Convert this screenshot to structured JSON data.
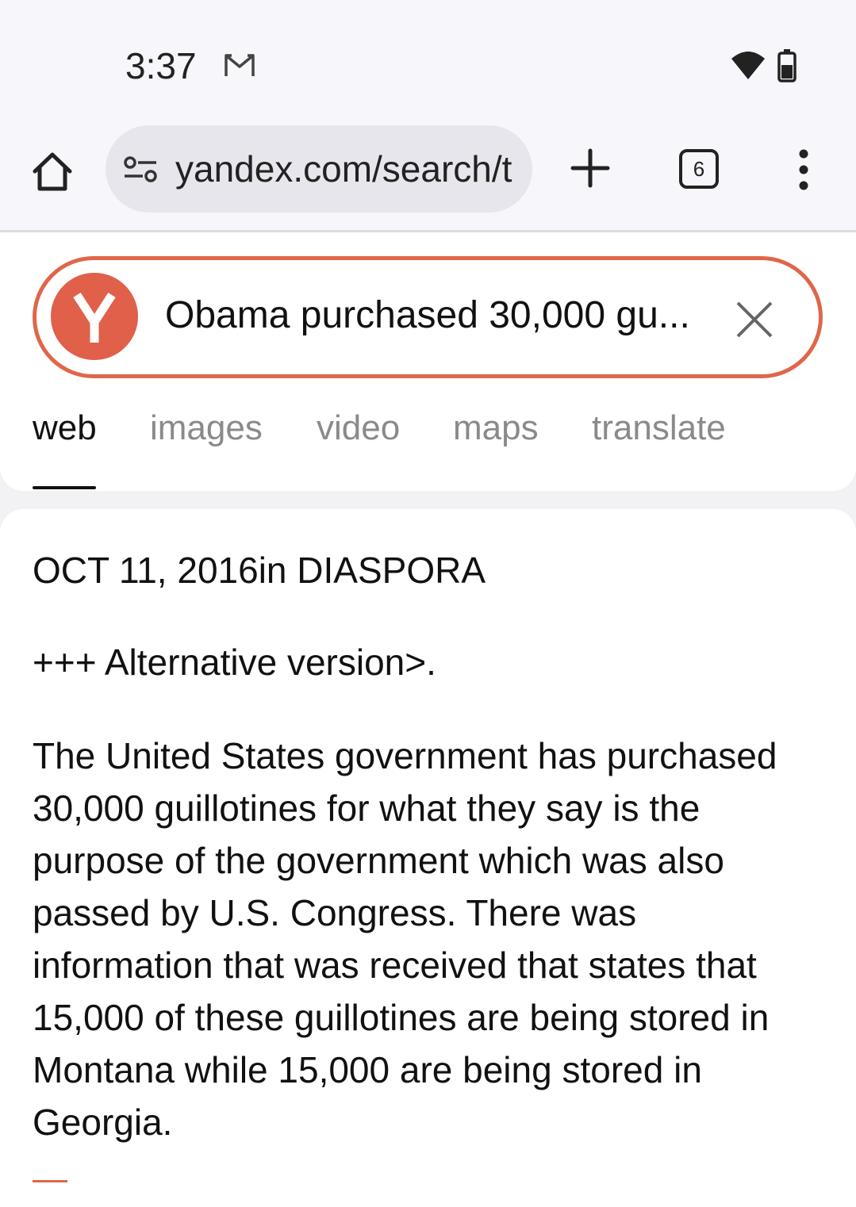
{
  "status_bar": {
    "time": "3:37",
    "icons": [
      "gmail-icon",
      "wifi-icon",
      "battery-icon"
    ]
  },
  "browser": {
    "url": "yandex.com/search/t",
    "tab_count": "6",
    "icons": [
      "home-icon",
      "tune-icon",
      "plus-icon",
      "tabs-icon",
      "menu-icon"
    ]
  },
  "search": {
    "logo_letter": "Y",
    "query": "Obama purchased 30,000 gu...",
    "accent_color": "#e0664a",
    "tabs": [
      {
        "label": "web",
        "active": true
      },
      {
        "label": "images",
        "active": false
      },
      {
        "label": "video",
        "active": false
      },
      {
        "label": "maps",
        "active": false
      },
      {
        "label": "translate",
        "active": false
      }
    ]
  },
  "result": {
    "meta": "OCT 11, 2016in DIASPORA",
    "alt_version": "+++ Alternative version>.",
    "body": "The United States government has purchased 30,000 guillotines for what they say is the purpose of the government which was also passed by U.S. Congress. There was information that was received that states that 15,000 of these guillotines are being stored in Montana while 15,000 are being stored in Georgia."
  }
}
